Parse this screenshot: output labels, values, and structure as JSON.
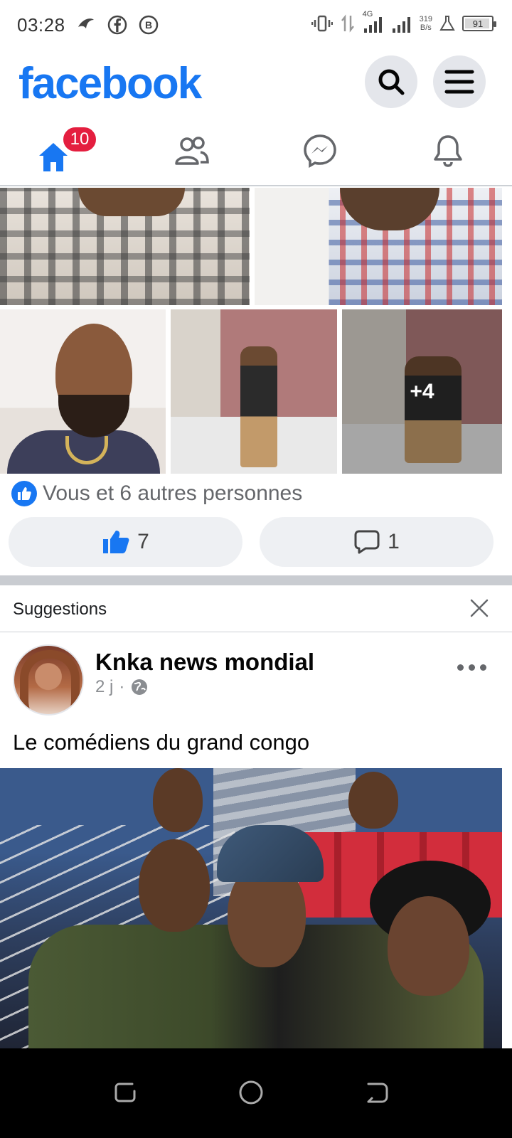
{
  "status_bar": {
    "time": "03:28",
    "network_type": "4G",
    "net_speed_value": "319",
    "net_speed_unit": "B/s",
    "battery_level": "91"
  },
  "header": {
    "logo_text": "facebook",
    "search_icon": "search-icon",
    "menu_icon": "hamburger-menu-icon"
  },
  "tabs": [
    {
      "name": "home",
      "icon": "home-icon",
      "badge": "10",
      "active": true
    },
    {
      "name": "friends",
      "icon": "friends-icon"
    },
    {
      "name": "messenger",
      "icon": "messenger-icon"
    },
    {
      "name": "notifications",
      "icon": "bell-icon"
    }
  ],
  "post1": {
    "more_photos": "+4",
    "reaction_text": "Vous et 6 autres personnes",
    "like_count": "7",
    "comment_count": "1"
  },
  "suggestions": {
    "title": "Suggestions"
  },
  "post2": {
    "author": "Knka news mondial",
    "time_ago": "2 j",
    "separator": "·",
    "caption": "Le comédiens du grand congo"
  },
  "colors": {
    "brand": "#1877f2",
    "badge": "#e41e3f",
    "pill_bg": "#eef0f3"
  }
}
